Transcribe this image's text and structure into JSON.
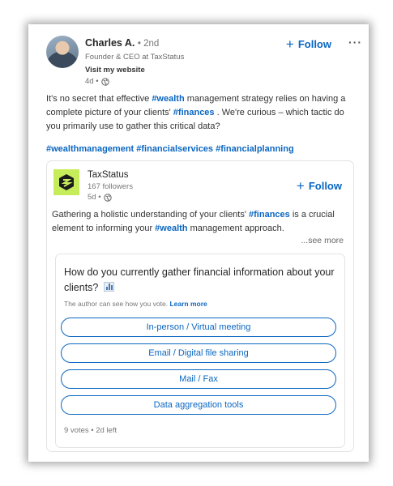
{
  "post": {
    "author_name": "Charles A.",
    "degree": "• 2nd",
    "headline": "Founder & CEO at TaxStatus",
    "visit_link": "Visit my website",
    "time": "4d •",
    "follow_label": "Follow",
    "more_label": "···",
    "text_1": "It's no secret that effective ",
    "tag_1": "#wealth",
    "text_2": " management strategy relies on having a complete picture of your clients' ",
    "tag_2": "#finances",
    "text_3": " . We're curious – which tactic do you primarily use to gather this critical data?",
    "hashtags": "#wealthmanagement #financialservices #financialplanning"
  },
  "shared": {
    "company_name": "TaxStatus",
    "followers": "167 followers",
    "time": "5d •",
    "follow_label": "Follow",
    "text_1": "Gathering a holistic understanding of your clients' ",
    "tag_1": "#finances",
    "text_2": " is a crucial element to informing your ",
    "tag_2": "#wealth",
    "text_3": " management approach.",
    "see_more": "...see more"
  },
  "poll": {
    "question": "How do you currently gather financial information about your clients?",
    "note": "The author can see how you vote.",
    "learn_more": "Learn more",
    "options": [
      "In-person / Virtual meeting",
      "Email / Digital file sharing",
      "Mail / Fax",
      "Data aggregation tools"
    ],
    "footer": "9 votes • 2d left"
  },
  "colors": {
    "accent": "#0a66c2",
    "logo_bg": "#c7ec5a"
  },
  "icons": [
    "globe-icon",
    "plus-icon",
    "more-icon",
    "bar-chart-icon",
    "taxstatus-logo"
  ]
}
